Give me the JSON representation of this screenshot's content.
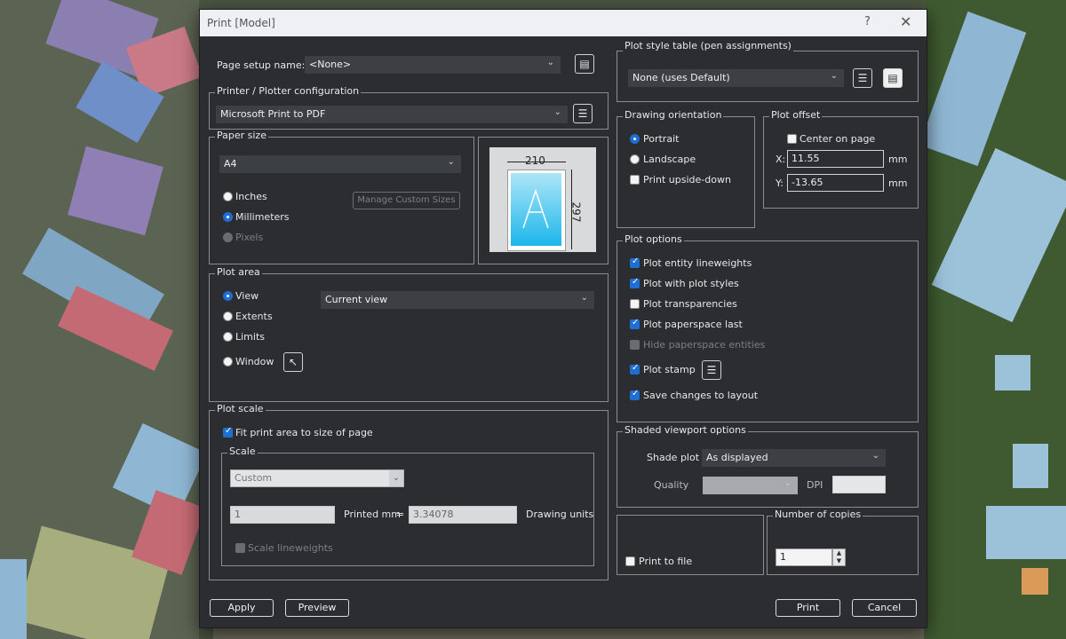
{
  "dialog": {
    "title": "Print [Model]",
    "help": "?",
    "close": "✕"
  },
  "page_setup": {
    "label": "Page setup name:",
    "value": "<None>"
  },
  "printer": {
    "legend": "Printer / Plotter configuration",
    "value": "Microsoft Print to PDF"
  },
  "paper": {
    "legend": "Paper size",
    "value": "A4",
    "units": [
      "Inches",
      "Millimeters",
      "Pixels"
    ],
    "selected_unit": "Millimeters",
    "manage_button": "Manage Custom Sizes",
    "preview_width": "210",
    "preview_height": "297"
  },
  "plot_area": {
    "legend": "Plot area",
    "options": [
      "View",
      "Extents",
      "Limits",
      "Window"
    ],
    "selected": "View",
    "view_value": "Current view"
  },
  "plot_scale": {
    "legend": "Plot scale",
    "fit_label": "Fit print area to size of page",
    "fit_checked": true,
    "scale_legend": "Scale",
    "scale_value": "Custom",
    "printed_value": "1",
    "printed_label": "Printed mm",
    "equals": "=",
    "units_value": "3.34078",
    "units_label": "Drawing units",
    "lineweights_label": "Scale lineweights"
  },
  "plot_style": {
    "legend": "Plot style table (pen assignments)",
    "value": "None (uses Default)"
  },
  "orientation": {
    "legend": "Drawing orientation",
    "options": [
      "Portrait",
      "Landscape"
    ],
    "selected": "Portrait",
    "upside_down": "Print upside-down"
  },
  "offset": {
    "legend": "Plot offset",
    "center_label": "Center on page",
    "x_label": "X:",
    "x_value": "11.55",
    "y_label": "Y:",
    "y_value": "-13.65",
    "unit": "mm"
  },
  "plot_options": {
    "legend": "Plot options",
    "items": [
      {
        "label": "Plot entity lineweights",
        "checked": true
      },
      {
        "label": "Plot with plot styles",
        "checked": true
      },
      {
        "label": "Plot transparencies",
        "checked": false
      },
      {
        "label": "Plot paperspace last",
        "checked": true
      },
      {
        "label": "Hide paperspace entities",
        "checked": false,
        "disabled": true
      },
      {
        "label": "Plot stamp",
        "checked": true
      },
      {
        "label": "Save changes to layout",
        "checked": true
      }
    ]
  },
  "shaded": {
    "legend": "Shaded viewport options",
    "shade_label": "Shade plot",
    "shade_value": "As displayed",
    "quality_label": "Quality",
    "dpi_label": "DPI"
  },
  "print_to_file": {
    "label": "Print to file"
  },
  "copies": {
    "legend": "Number of copies",
    "value": "1"
  },
  "buttons": {
    "apply": "Apply",
    "preview": "Preview",
    "print": "Print",
    "cancel": "Cancel"
  }
}
